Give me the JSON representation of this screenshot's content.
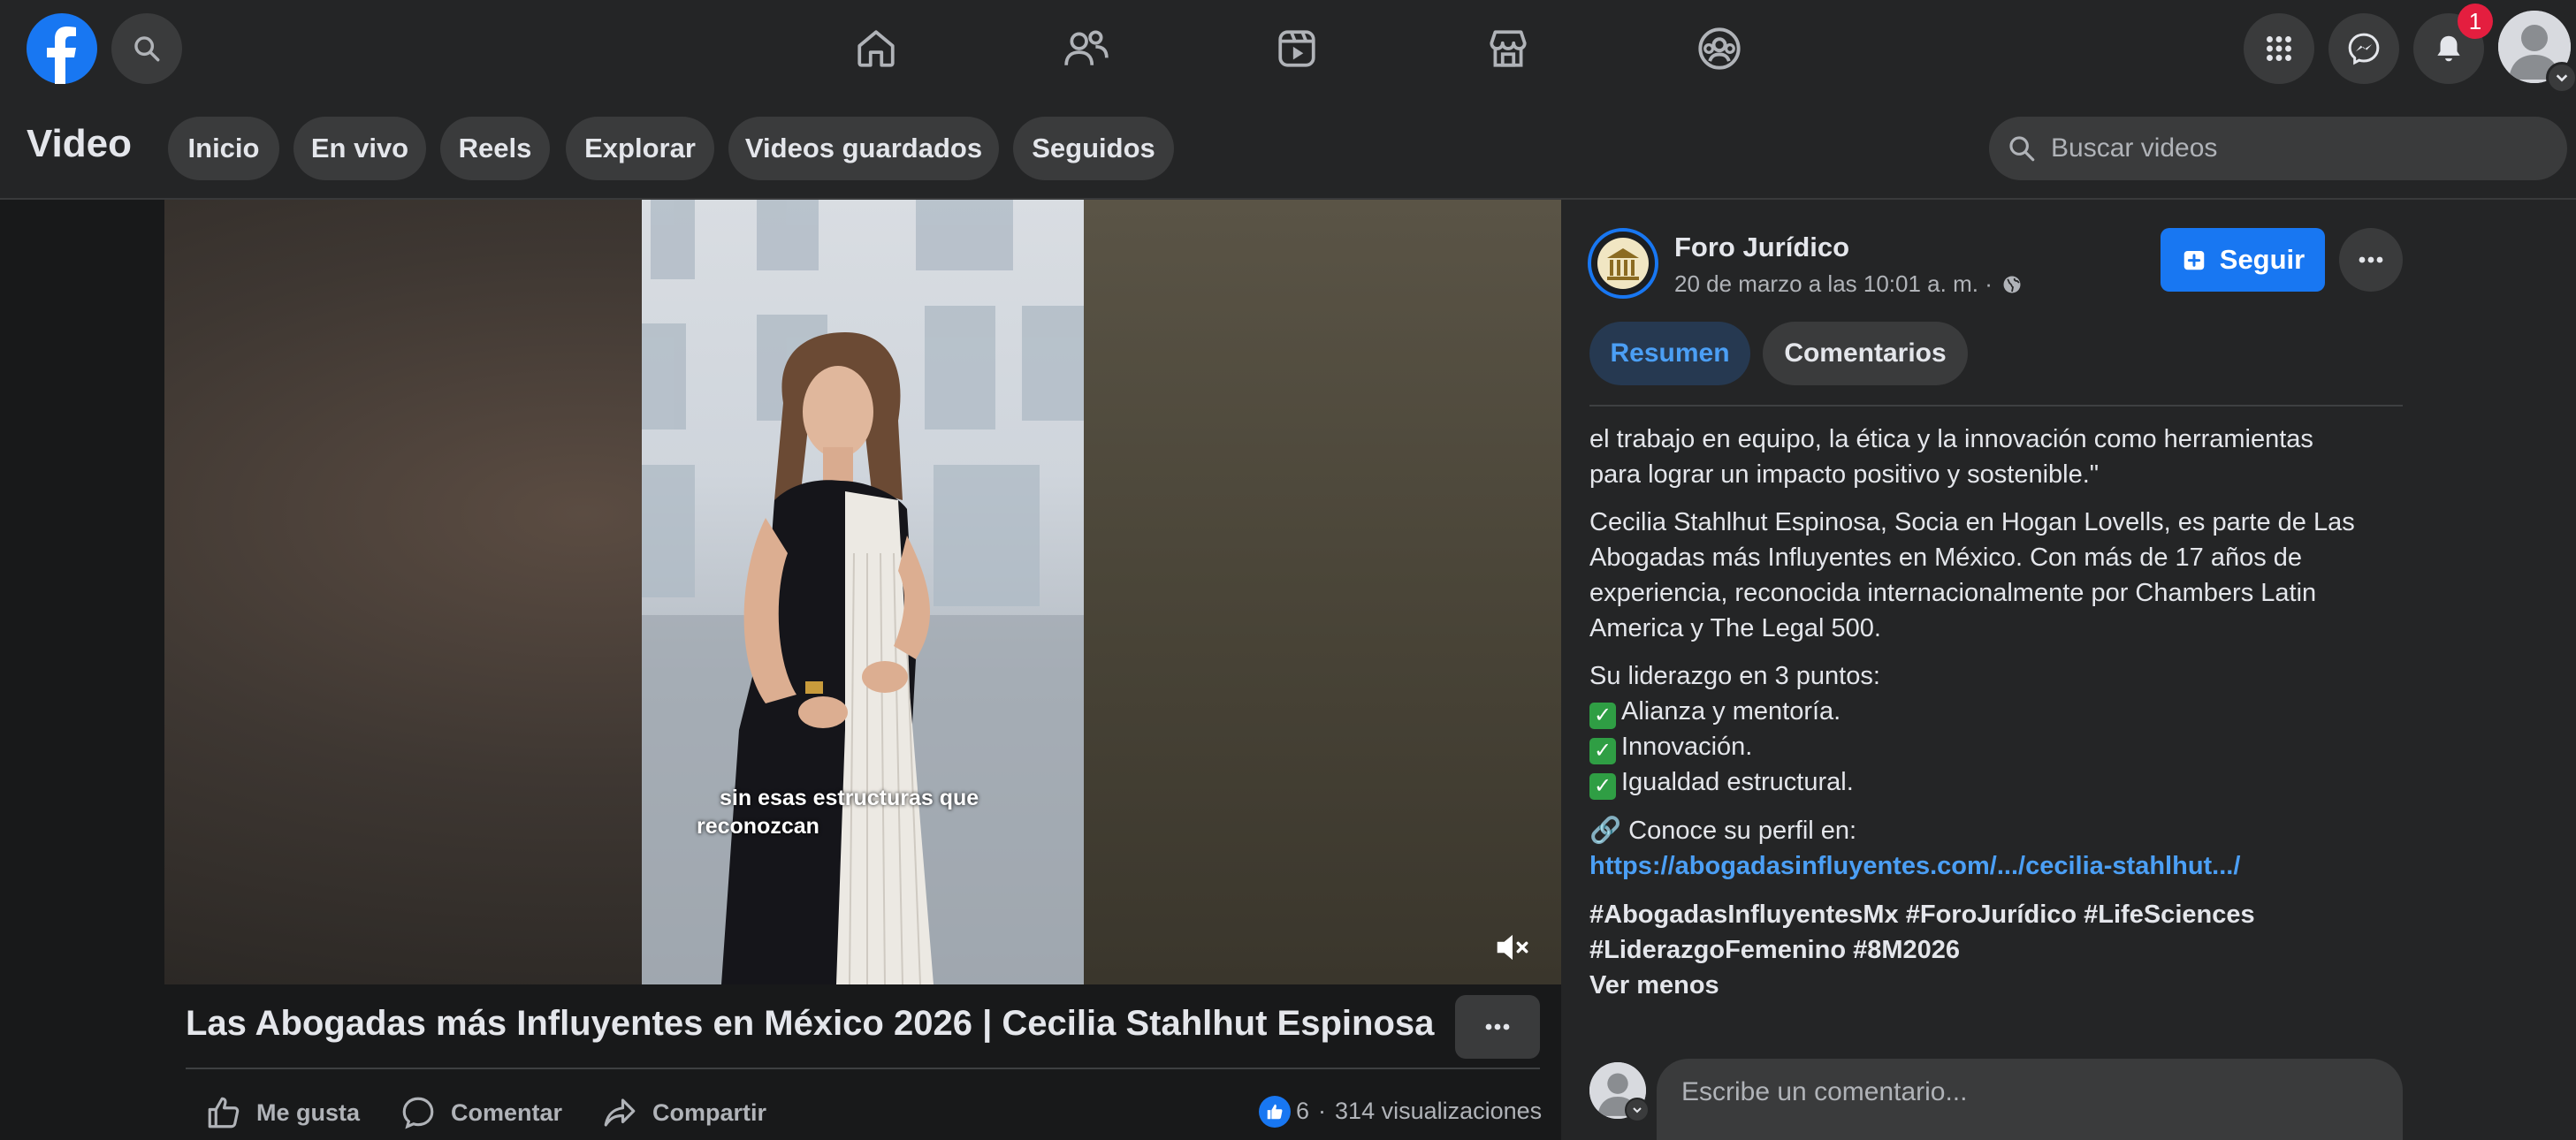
{
  "topbar": {
    "notification_count": "1",
    "nav_icons": [
      "home-icon",
      "friends-icon",
      "watch-icon",
      "marketplace-icon",
      "groups-icon"
    ]
  },
  "subheader": {
    "title": "Video",
    "pills": [
      "Inicio",
      "En vivo",
      "Reels",
      "Explorar",
      "Videos guardados",
      "Seguidos"
    ],
    "search_placeholder": "Buscar videos"
  },
  "video": {
    "caption_line1": "sin esas estructuras que",
    "caption_line2": "reconozcan",
    "title": "Las Abogadas más Influyentes en México 2026 | Cecilia Stahlhut Espinosa",
    "actions": {
      "like": "Me gusta",
      "comment": "Comentar",
      "share": "Compartir"
    },
    "reaction_count": "6",
    "separator": "·",
    "views": "314 visualizaciones"
  },
  "post": {
    "page_name": "Foro Jurídico",
    "time": "20 de marzo a las 10:01 a. m. ·",
    "follow_label": "Seguir",
    "tabs": [
      "Resumen",
      "Comentarios"
    ],
    "desc_line1": "el trabajo en equipo, la ética y la innovación como herramientas",
    "desc_line2": "para lograr un impacto positivo y sostenible.\"",
    "bio_lines": [
      "Cecilia Stahlhut Espinosa, Socia en Hogan Lovells, es parte de Las",
      "Abogadas más Influyentes en México. Con más de 17 años de",
      "experiencia, reconocida internacionalmente por Chambers Latin",
      "America y The Legal 500."
    ],
    "leadership_title": "Su liderazgo en 3 puntos:",
    "points": [
      "Alianza y mentoría.",
      "Innovación.",
      "Igualdad estructural."
    ],
    "profile_label": "🔗 Conoce su perfil en:",
    "profile_link": "https://abogadasinfluyentes.com/.../cecilia-stahlhut.../",
    "hashtags_line1": "#AbogadasInfluyentesMx #ForoJurídico #LifeSciences",
    "hashtags_line2": "#LiderazgoFemenino #8M2026",
    "see_less": "Ver menos",
    "comment_placeholder": "Escribe un comentario..."
  },
  "colors": {
    "background": "#18191a",
    "surface": "#242526",
    "accent": "#1877f2",
    "badge": "#e41e3f",
    "link": "#4b9ff5"
  }
}
